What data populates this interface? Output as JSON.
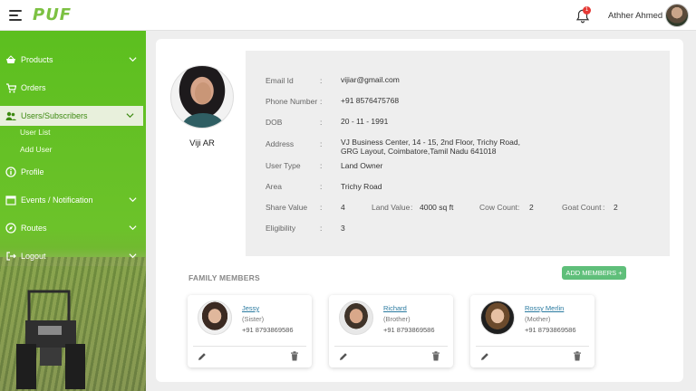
{
  "header": {
    "logo": "PUF",
    "notification_count": "1",
    "user_name": "Athher Ahmed"
  },
  "sidebar": {
    "items": [
      {
        "label": "Products",
        "icon": "basket-icon",
        "expandable": true
      },
      {
        "label": "Orders",
        "icon": "cart-icon",
        "expandable": false
      },
      {
        "label": "Users/Subscribers",
        "icon": "users-icon",
        "expandable": true,
        "active": true
      },
      {
        "label": "Profile",
        "icon": "info-icon",
        "expandable": false
      },
      {
        "label": "Events / Notification",
        "icon": "calendar-icon",
        "expandable": true
      },
      {
        "label": "Routes",
        "icon": "compass-icon",
        "expandable": true
      },
      {
        "label": "Logout",
        "icon": "logout-icon",
        "expandable": true
      }
    ],
    "subitems": [
      "User List",
      "Add User"
    ]
  },
  "profile": {
    "name": "Viji AR",
    "fields": {
      "email_label": "Email Id",
      "email": "vijiar@gmail.com",
      "phone_label": "Phone Number",
      "phone": "+91 8576475768",
      "dob_label": "DOB",
      "dob": "20 - 11 - 1991",
      "address_label": "Address",
      "address_line1": "VJ Business Center, 14 - 15, 2nd Floor, Trichy Road,",
      "address_line2": "GRG Layout, Coimbatore,Tamil Nadu 641018",
      "user_type_label": "User Type",
      "user_type": "Land Owner",
      "area_label": "Area",
      "area": "Trichy Road",
      "share_value_label": "Share Value",
      "share_value": "4",
      "land_value_label": "Land Value",
      "land_value": "4000 sq ft",
      "cow_count_label": "Cow Count",
      "cow_count": "2",
      "goat_count_label": "Goat Count",
      "goat_count": "2",
      "eligibility_label": "Eligibility",
      "eligibility": "3"
    }
  },
  "family": {
    "title": "FAMILY MEMBERS",
    "add_label": "ADD MEMBERS +",
    "members": [
      {
        "name": "Jessy",
        "relation": "(Sister)",
        "phone": "+91 8793869586"
      },
      {
        "name": "Richard",
        "relation": "(Brother)",
        "phone": "+91 8793869586"
      },
      {
        "name": "Rossy Merlin",
        "relation": "(Mother)",
        "phone": "+91 8793869586"
      }
    ]
  },
  "colors": {
    "sidebar_green": "#5cbf1f",
    "button_green": "#5fbf7a",
    "link_blue": "#2a7aa0",
    "badge_red": "#e53935"
  }
}
